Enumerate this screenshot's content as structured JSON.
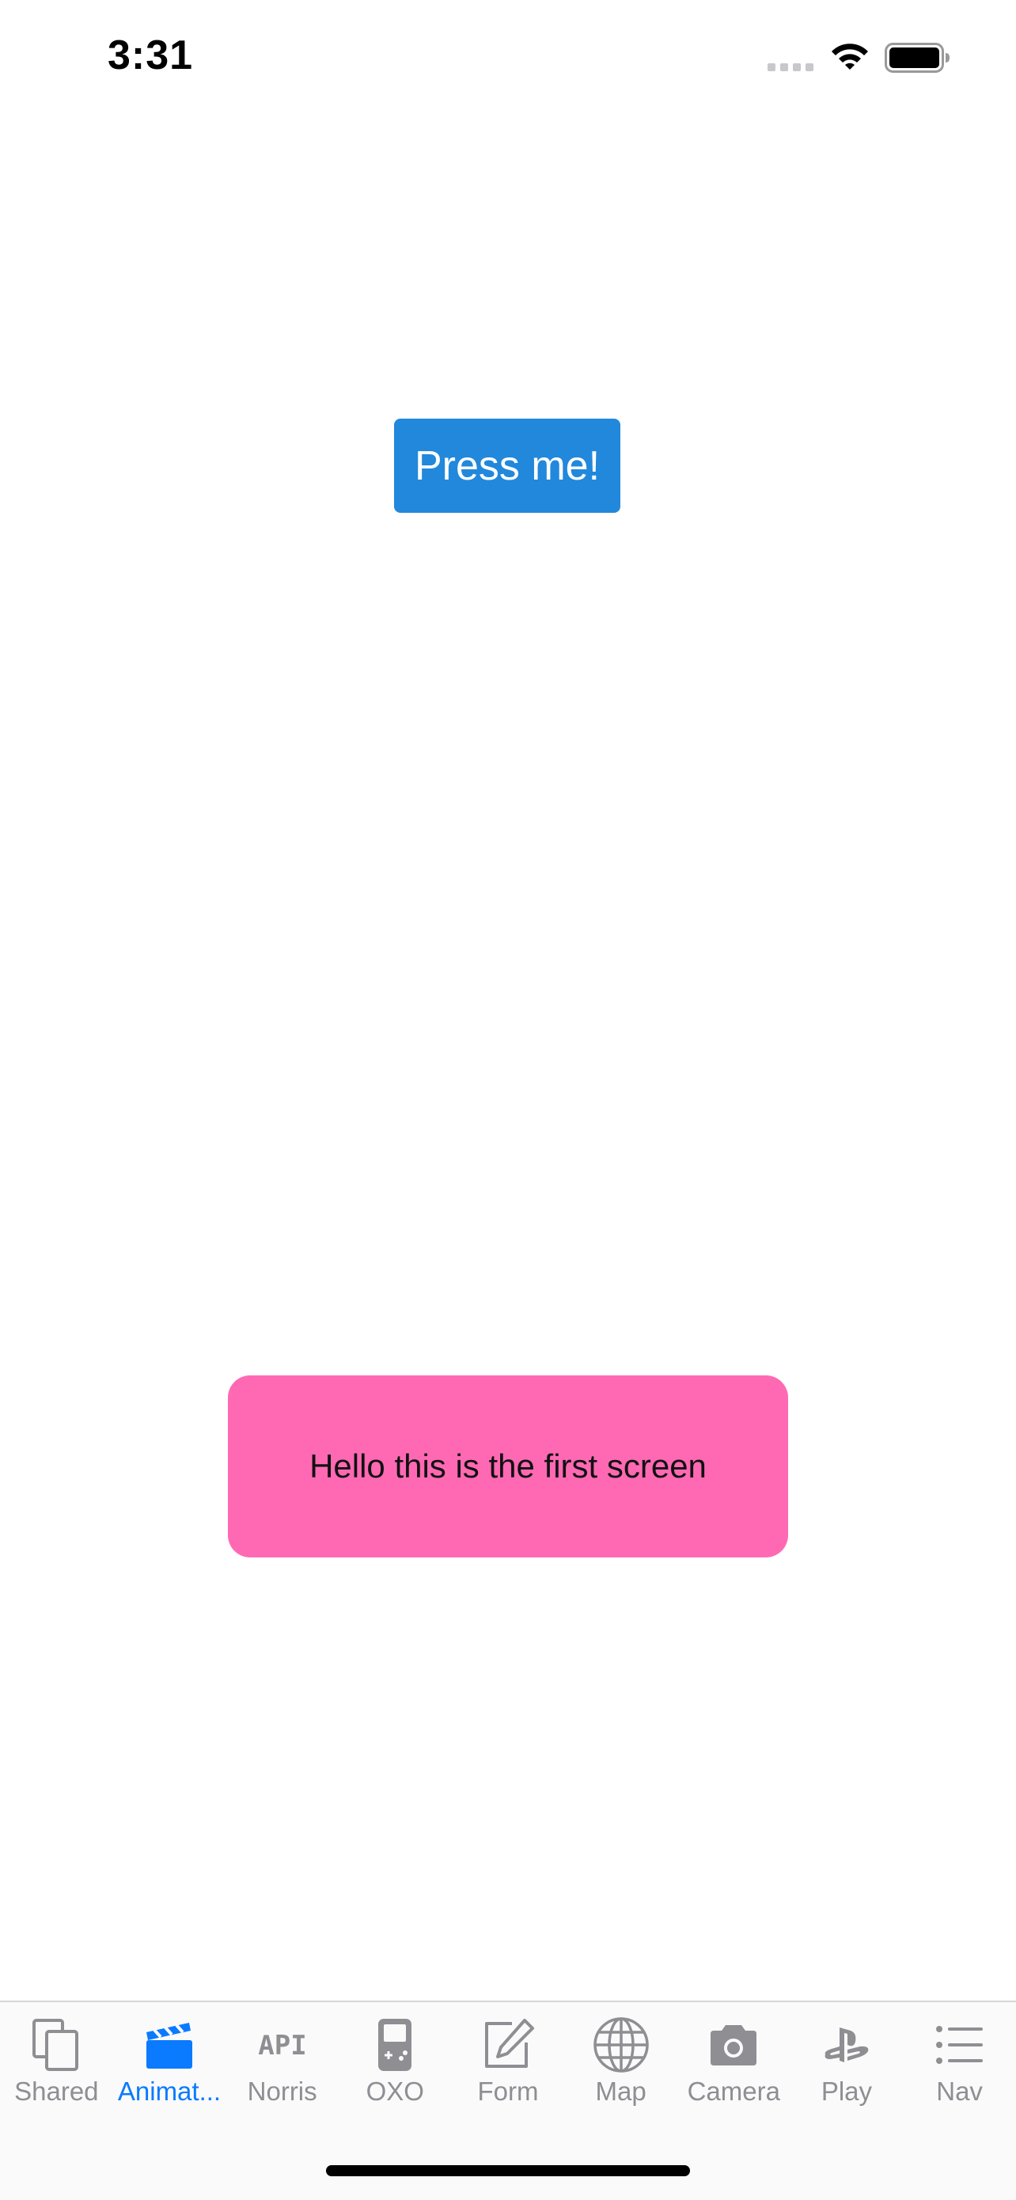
{
  "status_bar": {
    "time": "3:31"
  },
  "main": {
    "button_label": "Press me!",
    "card_text": "Hello this is the first screen"
  },
  "colors": {
    "button": "#2188dc",
    "card": "#ff69b4",
    "tab_active": "#0a7aff",
    "tab_inactive": "#8e8e93"
  },
  "tab_bar": {
    "active_index": 1,
    "items": [
      {
        "label": "Shared",
        "icon": "copy-icon"
      },
      {
        "label": "Animat...",
        "icon": "clapperboard-icon"
      },
      {
        "label": "Norris",
        "icon": "api-icon"
      },
      {
        "label": "OXO",
        "icon": "gameboy-icon"
      },
      {
        "label": "Form",
        "icon": "edit-icon"
      },
      {
        "label": "Map",
        "icon": "globe-icon"
      },
      {
        "label": "Camera",
        "icon": "camera-icon"
      },
      {
        "label": "Play",
        "icon": "playstation-icon"
      },
      {
        "label": "Nav",
        "icon": "list-icon"
      }
    ]
  }
}
